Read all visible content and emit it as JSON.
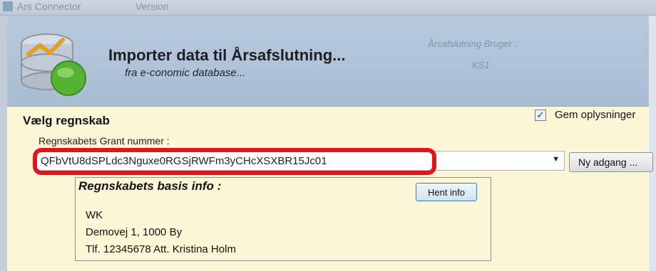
{
  "window": {
    "title": "Ars Connector",
    "title_right": "Version"
  },
  "header": {
    "title": "Importer data til Årsafslutning...",
    "subtitle": "fra e-conomic database...",
    "user_label": "Årsafslutning Bruger :",
    "user_value": "KS1"
  },
  "form": {
    "section_title": "Vælg regnskab",
    "remember_label": "Gem oplysninger",
    "remember_checked": true,
    "grant_label": "Regnskabets Grant nummer :",
    "grant_value": "QFbVtU8dSPLdc3Nguxe0RGSjRWFm3yCHcXSXBR15Jc01",
    "new_access_button": "Ny adgang ..."
  },
  "info": {
    "title": "Regnskabets basis info :",
    "fetch_button": "Hent info",
    "lines": [
      "WK",
      "Demovej 1, 1000 By",
      "Tlf. 12345678   Att. Kristina Holm"
    ]
  },
  "colors": {
    "highlight": "#e3131b",
    "panel": "#fcf8d7",
    "header": "#b2c5da"
  },
  "icons": {
    "logo": "database-logo-icon",
    "checkbox": "check-icon",
    "dropdown": "chevron-down-icon"
  }
}
